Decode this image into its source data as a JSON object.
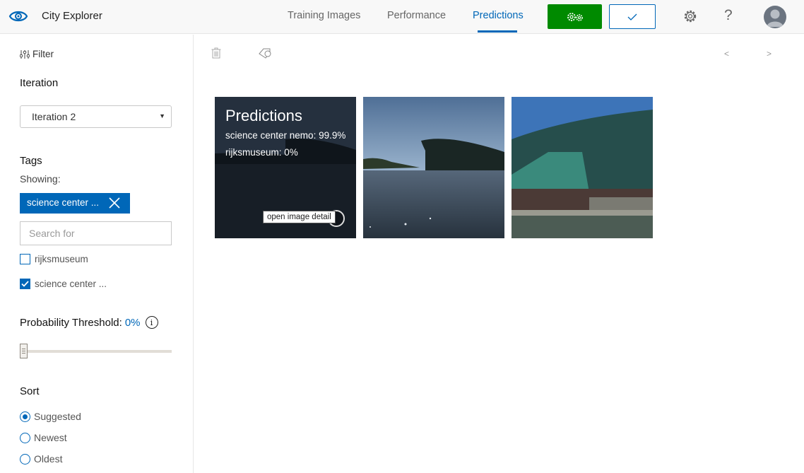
{
  "header": {
    "app_title": "City Explorer",
    "tabs": [
      {
        "label": "Training Images",
        "active": false
      },
      {
        "label": "Performance",
        "active": false
      },
      {
        "label": "Predictions",
        "active": true
      }
    ],
    "train_button_icon": "gears-icon",
    "quick_test_button_icon": "check-icon",
    "settings_icon": "gear-icon",
    "help_label": "?",
    "avatar_icon": "user-avatar-icon",
    "colors": {
      "accent": "#0067b8",
      "train_button": "#008a00"
    }
  },
  "sidebar": {
    "filter_label": "Filter",
    "iteration": {
      "title": "Iteration",
      "selected": "Iteration 2"
    },
    "tags": {
      "title": "Tags",
      "showing_label": "Showing:",
      "active_chip": "science center ...",
      "search_placeholder": "Search for",
      "items": [
        {
          "label": "rijksmuseum",
          "checked": false
        },
        {
          "label": "science center ...",
          "checked": true
        }
      ]
    },
    "threshold": {
      "label": "Probability Threshold:",
      "value": "0%",
      "slider_fraction": 0.0
    },
    "sort": {
      "title": "Sort",
      "options": [
        {
          "label": "Suggested",
          "selected": true
        },
        {
          "label": "Newest",
          "selected": false
        },
        {
          "label": "Oldest",
          "selected": false
        }
      ]
    }
  },
  "main": {
    "toolbar": {
      "delete_icon": "trash-icon",
      "tag_icon": "tag-icon",
      "prev_label": "<",
      "next_label": ">"
    },
    "images": [
      {
        "description": "NEMO science center across water (hovered)",
        "overlay": {
          "title": "Predictions",
          "predictions": [
            "science center nemo: 99.9%",
            "rijksmuseum: 0%"
          ],
          "tooltip": "open image detail"
        }
      },
      {
        "description": "NEMO science center silhouette over water"
      },
      {
        "description": "NEMO science center green facade close-up"
      }
    ]
  }
}
